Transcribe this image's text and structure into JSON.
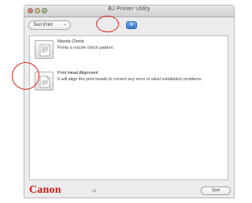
{
  "window": {
    "title": "BJ Printer Utility"
  },
  "toolbar": {
    "selected_option": "Test Print",
    "options_icon": "chevron-down-icon",
    "nav_button_glyph": "▾"
  },
  "items": [
    {
      "title": "Nozzle Check",
      "description": "Prints a nozzle check pattern.",
      "icon": "nozzle-check-icon"
    },
    {
      "title": "Print Head Alignment",
      "description": "It will align the print heads to correct any error or ideal installation problems.",
      "icon": "print-head-alignment-icon"
    }
  ],
  "footer": {
    "logo": "Canon",
    "logo_sub": "cp",
    "button_label": "Quit"
  },
  "colors": {
    "annotation": "#d8231b",
    "canon_red": "#c61d17",
    "accent_blue": "#3c76cf"
  }
}
